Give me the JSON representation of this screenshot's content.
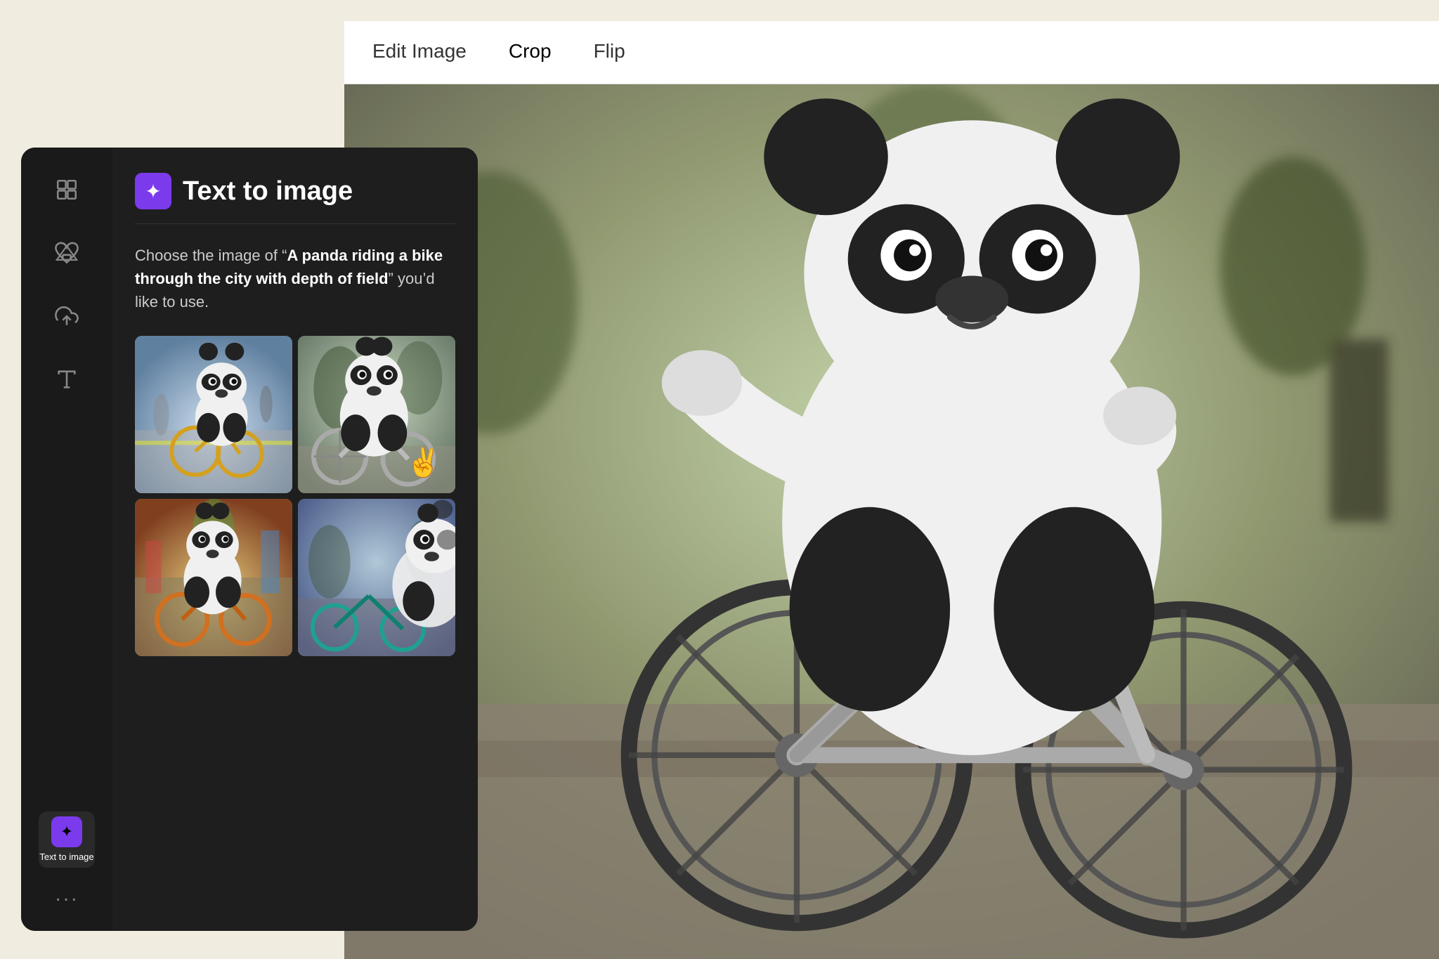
{
  "background_color": "#f0ede0",
  "toolbar": {
    "tabs": [
      {
        "id": "edit-image",
        "label": "Edit Image",
        "active": false
      },
      {
        "id": "crop",
        "label": "Crop",
        "active": false
      },
      {
        "id": "flip",
        "label": "Flip",
        "active": false
      }
    ]
  },
  "sidebar": {
    "icons": [
      {
        "id": "layout",
        "label": "",
        "symbol": "layout",
        "active": false
      },
      {
        "id": "elements",
        "label": "",
        "symbol": "elements",
        "active": false
      },
      {
        "id": "upload",
        "label": "",
        "symbol": "upload",
        "active": false
      },
      {
        "id": "text",
        "label": "",
        "symbol": "text",
        "active": false
      },
      {
        "id": "text-to-image",
        "label": "Text to image",
        "symbol": "tti",
        "active": true
      }
    ],
    "more_label": "···"
  },
  "tti_panel": {
    "title": "Text to image",
    "icon_bg": "#7c3aed",
    "description_prefix": "Choose the image of “",
    "description_bold": "A panda riding a bike through the city with depth of field",
    "description_suffix": "” you’d like to use.",
    "images": [
      {
        "id": "img-1",
        "alt": "Panda on yellow bike street scene"
      },
      {
        "id": "img-2",
        "alt": "Panda on silver bike side view"
      },
      {
        "id": "img-3",
        "alt": "Panda on orange bike colorful city"
      },
      {
        "id": "img-4",
        "alt": "Panda on teal bike partial view"
      }
    ]
  },
  "main_image": {
    "alt": "Panda riding a silver bike, depth of field"
  }
}
